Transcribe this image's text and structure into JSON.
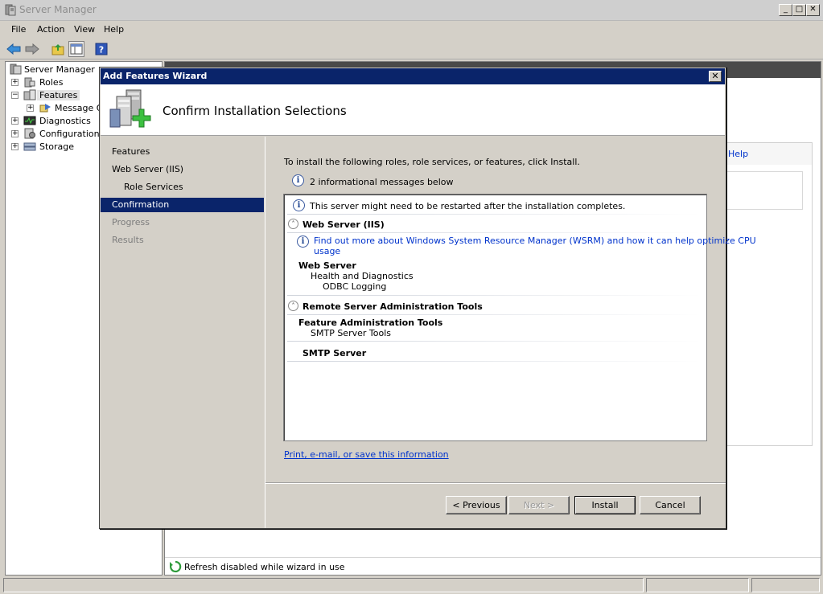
{
  "window": {
    "title": "Server Manager",
    "controls": [
      "_",
      "□",
      "✕"
    ]
  },
  "menu": [
    "File",
    "Action",
    "View",
    "Help"
  ],
  "tree": {
    "root": "Server Manager",
    "items": [
      {
        "label": "Roles"
      },
      {
        "label": "Features"
      },
      {
        "label": "Message Qu"
      },
      {
        "label": "Diagnostics"
      },
      {
        "label": "Configuration"
      },
      {
        "label": "Storage"
      }
    ]
  },
  "right_pane": {
    "help_link": "Help",
    "refresh_status": "Refresh disabled while wizard in use"
  },
  "dialog": {
    "title": "Add Features Wizard",
    "header": "Confirm Installation Selections",
    "nav": [
      {
        "label": "Features"
      },
      {
        "label": "Web Server (IIS)"
      },
      {
        "label": "Role Services"
      },
      {
        "label": "Confirmation"
      },
      {
        "label": "Progress"
      },
      {
        "label": "Results"
      }
    ],
    "instruction": "To install the following roles, role services, or features, click Install.",
    "info_count": "2 informational messages below",
    "list": {
      "restart_msg": "This server might need to be restarted after the installation completes.",
      "section1": "Web Server (IIS)",
      "wsrm_link_line1": "Find out more about Windows System Resource Manager (WSRM) and how it can help optimize CPU",
      "wsrm_link_line2": "usage",
      "web_server": "Web Server",
      "health": "Health and Diagnostics",
      "odbc": "ODBC Logging",
      "section2": "Remote Server Administration Tools",
      "feature_admin": "Feature Administration Tools",
      "smtp_tools": "SMTP Server Tools",
      "smtp_server": "SMTP Server"
    },
    "print_link": "Print, e-mail, or save this information",
    "buttons": {
      "previous": "< Previous",
      "next": "Next >",
      "install": "Install",
      "cancel": "Cancel"
    }
  },
  "colors": {
    "title_active": "#0a246a",
    "link": "#0033cc",
    "face": "#d4d0c8"
  }
}
